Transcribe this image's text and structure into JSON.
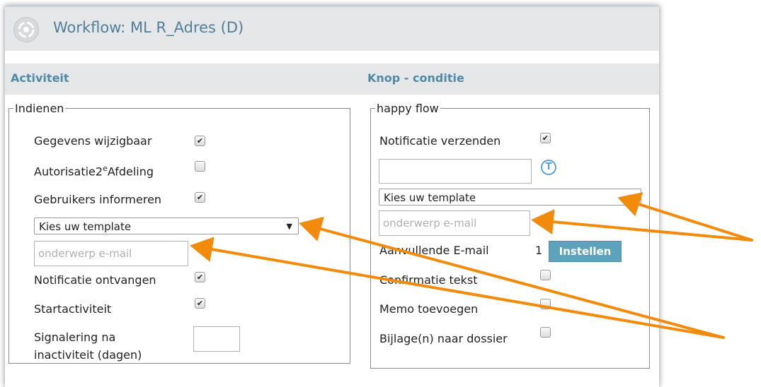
{
  "window": {
    "title": "Workflow: ML R_Adres (D)"
  },
  "header": {
    "left_label": "Activiteit",
    "right_label": "Knop - conditie"
  },
  "left": {
    "legend": "Indienen",
    "rows": {
      "gegevens": {
        "label": "Gegevens wijzigbaar",
        "checked": true
      },
      "autorisatie": {
        "label_pre": "Autorisatie2",
        "label_sup": "e",
        "label_post": "Afdeling",
        "checked": false
      },
      "informeren": {
        "label": "Gebruikers informeren",
        "checked": true
      },
      "notificatie": {
        "label": "Notificatie ontvangen",
        "checked": true
      },
      "start": {
        "label": "Startactiviteit",
        "checked": true
      },
      "signalering_1": "Signalering na",
      "signalering_2": "inactiviteit (dagen)"
    },
    "template_select": "Kies uw template",
    "subject_placeholder": "onderwerp e-mail"
  },
  "right": {
    "legend": "happy flow",
    "rows": {
      "notificatie": {
        "label": "Notificatie verzenden",
        "checked": true
      },
      "aanvullende": {
        "label": "Aanvullende E-mail",
        "count": "1"
      },
      "confirmatie": {
        "label": "Confirmatie tekst",
        "checked": false
      },
      "memo": {
        "label": "Memo toevoegen",
        "checked": false
      },
      "bijlage": {
        "label": "Bijlage(n) naar dossier",
        "checked": false
      }
    },
    "template_select": "Kies uw template",
    "subject_placeholder": "onderwerp e-mail",
    "instellen_button": "Instellen",
    "t_icon": "T"
  },
  "icons": {
    "logo": "workflow-logo-icon",
    "check": "✔",
    "dropdown": "▼"
  },
  "colors": {
    "title": "#4f7f99",
    "header_label": "#4f8aa6",
    "button": "#5ea3bd",
    "annotation": "#f28a0c"
  }
}
